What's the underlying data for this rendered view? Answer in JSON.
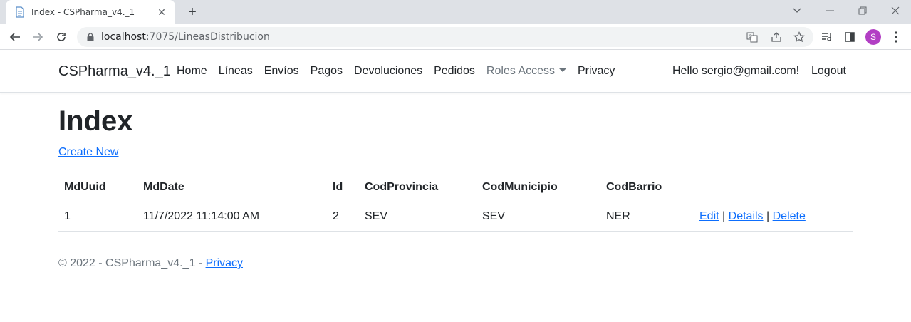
{
  "browser": {
    "tab_title": "Index - CSPharma_v4._1",
    "url_host": "localhost",
    "url_path": ":7075/LineasDistribucion",
    "avatar_letter": "S"
  },
  "navbar": {
    "brand": "CSPharma_v4._1",
    "links": [
      "Home",
      "Líneas",
      "Envíos",
      "Pagos",
      "Devoluciones",
      "Pedidos"
    ],
    "roles_access": "Roles Access",
    "privacy": "Privacy",
    "hello": "Hello sergio@gmail.com!",
    "logout": "Logout"
  },
  "main": {
    "title": "Index",
    "create_new": "Create New",
    "table": {
      "headers": [
        "MdUuid",
        "MdDate",
        "Id",
        "CodProvincia",
        "CodMunicipio",
        "CodBarrio",
        ""
      ],
      "rows": [
        {
          "MdUuid": "1",
          "MdDate": "11/7/2022 11:14:00 AM",
          "Id": "2",
          "CodProvincia": "SEV",
          "CodMunicipio": "SEV",
          "CodBarrio": "NER",
          "edit": "Edit",
          "details": "Details",
          "delete": "Delete",
          "sep": "|"
        }
      ]
    }
  },
  "footer": {
    "copyright": "© 2022 - CSPharma_v4._1 - ",
    "privacy": "Privacy"
  },
  "colors": {
    "link": "#0d6efd",
    "avatar": "#b23fc4",
    "tabstrip": "#dee1e6"
  }
}
